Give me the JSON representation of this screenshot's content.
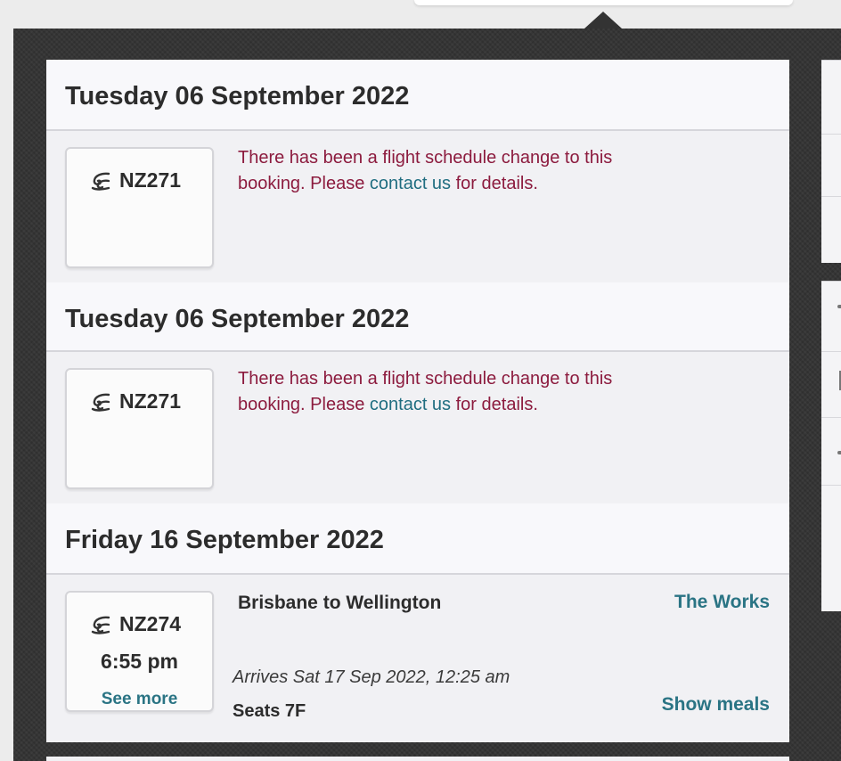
{
  "days": [
    {
      "date": "Tuesday 06 September 2022",
      "flight": {
        "airline_icon": "koru-icon",
        "number": "NZ271"
      },
      "notice": {
        "text_before": "There has been a flight schedule change to this booking. Please ",
        "link": "contact us",
        "text_after": " for details."
      }
    },
    {
      "date": "Tuesday 06 September 2022",
      "flight": {
        "airline_icon": "koru-icon",
        "number": "NZ271"
      },
      "notice": {
        "text_before": "There has been a flight schedule change to this booking. Please ",
        "link": "contact us",
        "text_after": " for details."
      }
    },
    {
      "date": "Friday 16 September 2022",
      "flight": {
        "airline_icon": "koru-icon",
        "number": "NZ274",
        "departure_time": "6:55 pm",
        "see_more": "See more"
      },
      "route": "Brisbane to Wellington",
      "fare": "The Works",
      "arrives": "Arrives Sat 17 Sep 2022, 12:25 am",
      "seats": "Seats 7F",
      "meals": "Show meals"
    }
  ],
  "colors": {
    "notice_text": "#8c1b3e",
    "link": "#1f6d80",
    "accent": "#2a7484",
    "panel_bg": "#333333",
    "card_bg": "#f1f1f4"
  }
}
